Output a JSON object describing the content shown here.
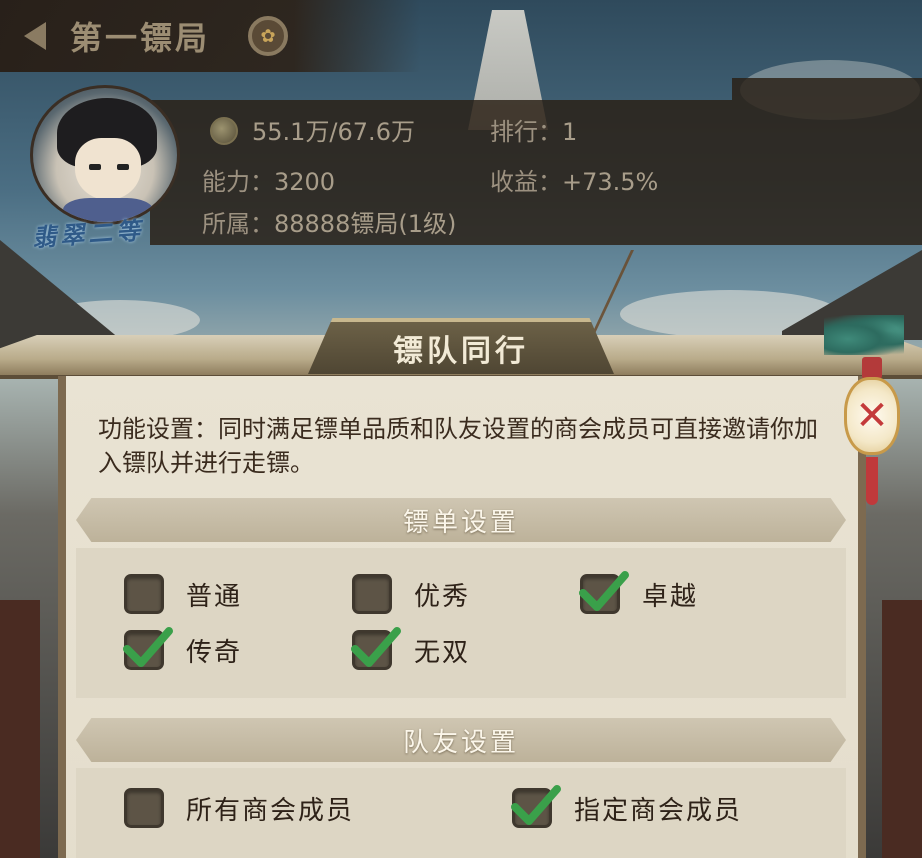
{
  "header": {
    "title": "第一镖局"
  },
  "player": {
    "rank_badge": "翡翠二等",
    "silver": "55.1万/67.6万",
    "ranking_label": "排行：",
    "ranking_value": "1",
    "ability_label": "能力：",
    "ability_value": "3200",
    "income_label": "收益：",
    "income_value": "+73.5%",
    "affiliation_label": "所属：",
    "affiliation_value": "88888镖局(1级)"
  },
  "dialog": {
    "title": "镖队同行",
    "description": "功能设置：同时满足镖单品质和队友设置的商会成员可直接邀请你加入镖队并进行走镖。",
    "order_section": {
      "title": "镖单设置",
      "options": [
        {
          "label": "普通",
          "checked": false
        },
        {
          "label": "优秀",
          "checked": false
        },
        {
          "label": "卓越",
          "checked": true
        },
        {
          "label": "传奇",
          "checked": true
        },
        {
          "label": "无双",
          "checked": true
        }
      ]
    },
    "teammate_section": {
      "title": "队友设置",
      "options": [
        {
          "label": "所有商会成员",
          "checked": false
        },
        {
          "label": "指定商会成员",
          "checked": true
        }
      ]
    }
  },
  "colors": {
    "check_green": "#3aa04a",
    "panel_bg": "#e6dfce",
    "plaque_bg": "#5a5039"
  }
}
